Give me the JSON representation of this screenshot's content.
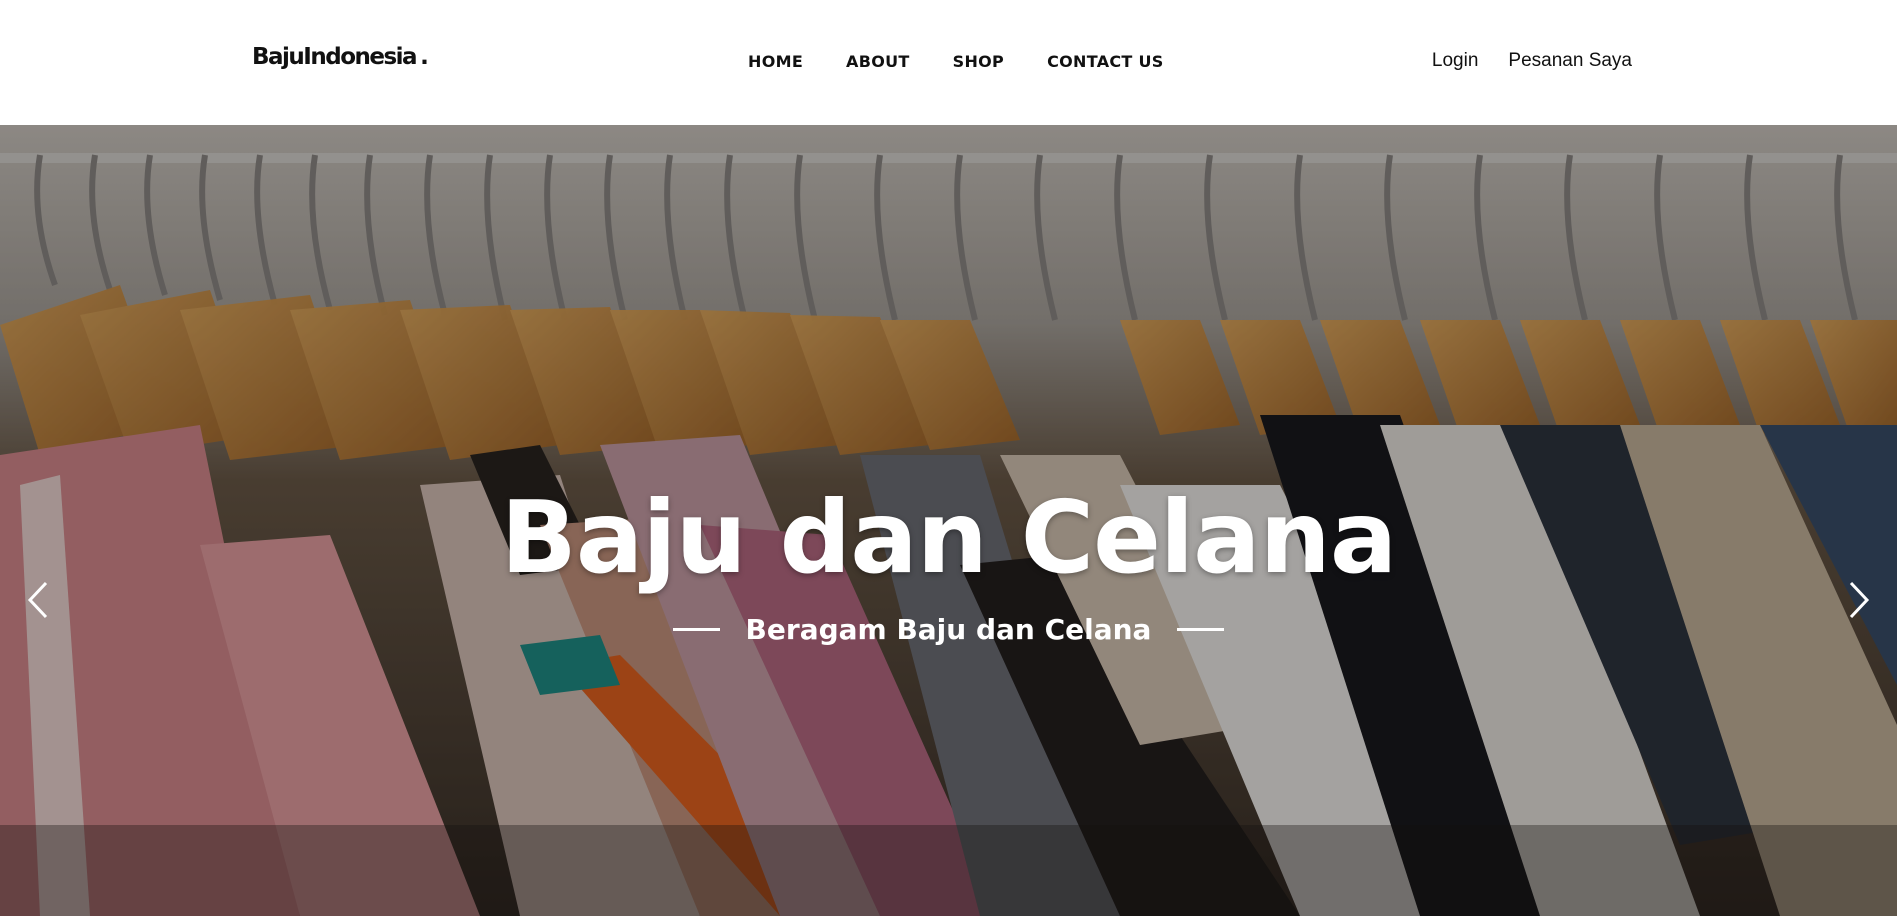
{
  "header": {
    "logo": "BajuIndonesia",
    "logo_dot": ".",
    "nav": [
      "HOME",
      "ABOUT",
      "SHOP",
      "CONTACT US"
    ],
    "right_links": [
      "Login",
      "Pesanan Saya"
    ]
  },
  "hero": {
    "title": "Baju dan Celana",
    "subtitle": "Beragam Baju dan Celana",
    "prev_icon": "chevron-left-icon",
    "next_icon": "chevron-right-icon"
  }
}
